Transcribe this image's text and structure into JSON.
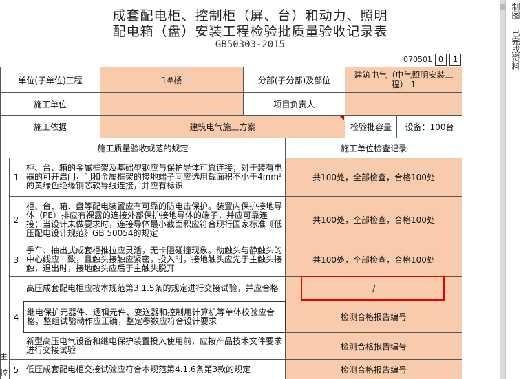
{
  "header": {
    "title_line1": "成套配电柜、控制柜（屏、台）和动力、照明",
    "title_line2": "配电箱（盘）安装工程检验批质量验收记录表",
    "standard": "GB50303-2015",
    "doc_no": "070501",
    "box1": "0",
    "box2": "1"
  },
  "info": {
    "unit_label": "单位(子单位)工程",
    "unit_value": "1#楼",
    "sub_label": "分部(子分部)及部位",
    "sub_value": "建筑电气（电气照明安装工程） 1",
    "contractor_label": "施工单位",
    "manager_label": "项目负责人",
    "basis_label": "施工依据",
    "basis_value": "建筑电气施工方案",
    "capacity_label": "检验批容量",
    "capacity_value": "设备：100台"
  },
  "table": {
    "spec_header": "施工质量验收规范的规定",
    "record_header": "施工单位检查记录",
    "side_chars": [
      "主",
      "控"
    ],
    "rows": [
      {
        "num": "1",
        "text": "柜、台、箱的金属框架及基础型钢应与保护导体可靠连接；对于装有电器的可开启门，门和金属框架的接地端子间应选用截面积不小于4mm²的黄绿色绝缘铜芯软导线连接，并应有标识",
        "record": "共100处，全部检查，合格100处"
      },
      {
        "num": "2",
        "text": "柜、台、箱、盘等配电装置应有可靠的防电击保护。装置内保护接地导体（PE）排应有裸露的连接外部保护接地导体的端子，并应可靠连接；当设计未做要求时，连接导体最小截面积应符合现行国家标准《低压配电设计规范》GB 50054的规定",
        "record": "共100处，全部检查，合格100处"
      },
      {
        "num": "3",
        "text": "手车、抽出式成套柜推拉应灵活，无卡阻碰撞现象。动触头与静触头的中心线应一致，且触头接触应紧密，投入时，接地触头应先于主触头接触，退出时，接地触头应后于主触头脱开",
        "record": "共100处，全部检查，合格100处"
      },
      {
        "num": "4",
        "sub": [
          {
            "text": "高压成套配电柜应按本规范第3.1.5条的规定进行交接试验，并应合格",
            "record": "/"
          },
          {
            "text": "继电保护元器件、逻辑元件、变送器和控制用计算机等单体校验应合格，整组试验动作应正确，整定参数应符合设计要求",
            "record": "检测合格报告编号"
          },
          {
            "text": "新型高压电气设备和继电保护装置投入使用前，应按产品技术文件要求进行交接试验",
            "record": "检测合格报告编号"
          }
        ]
      },
      {
        "num": "5",
        "text": "低压成套配电柜交接试验应符合本规范第4.1.6条第3款的规定",
        "record": "检测合格报告编号"
      }
    ]
  },
  "side_panel": {
    "text1": "制图",
    "text2": "已完成资料"
  }
}
